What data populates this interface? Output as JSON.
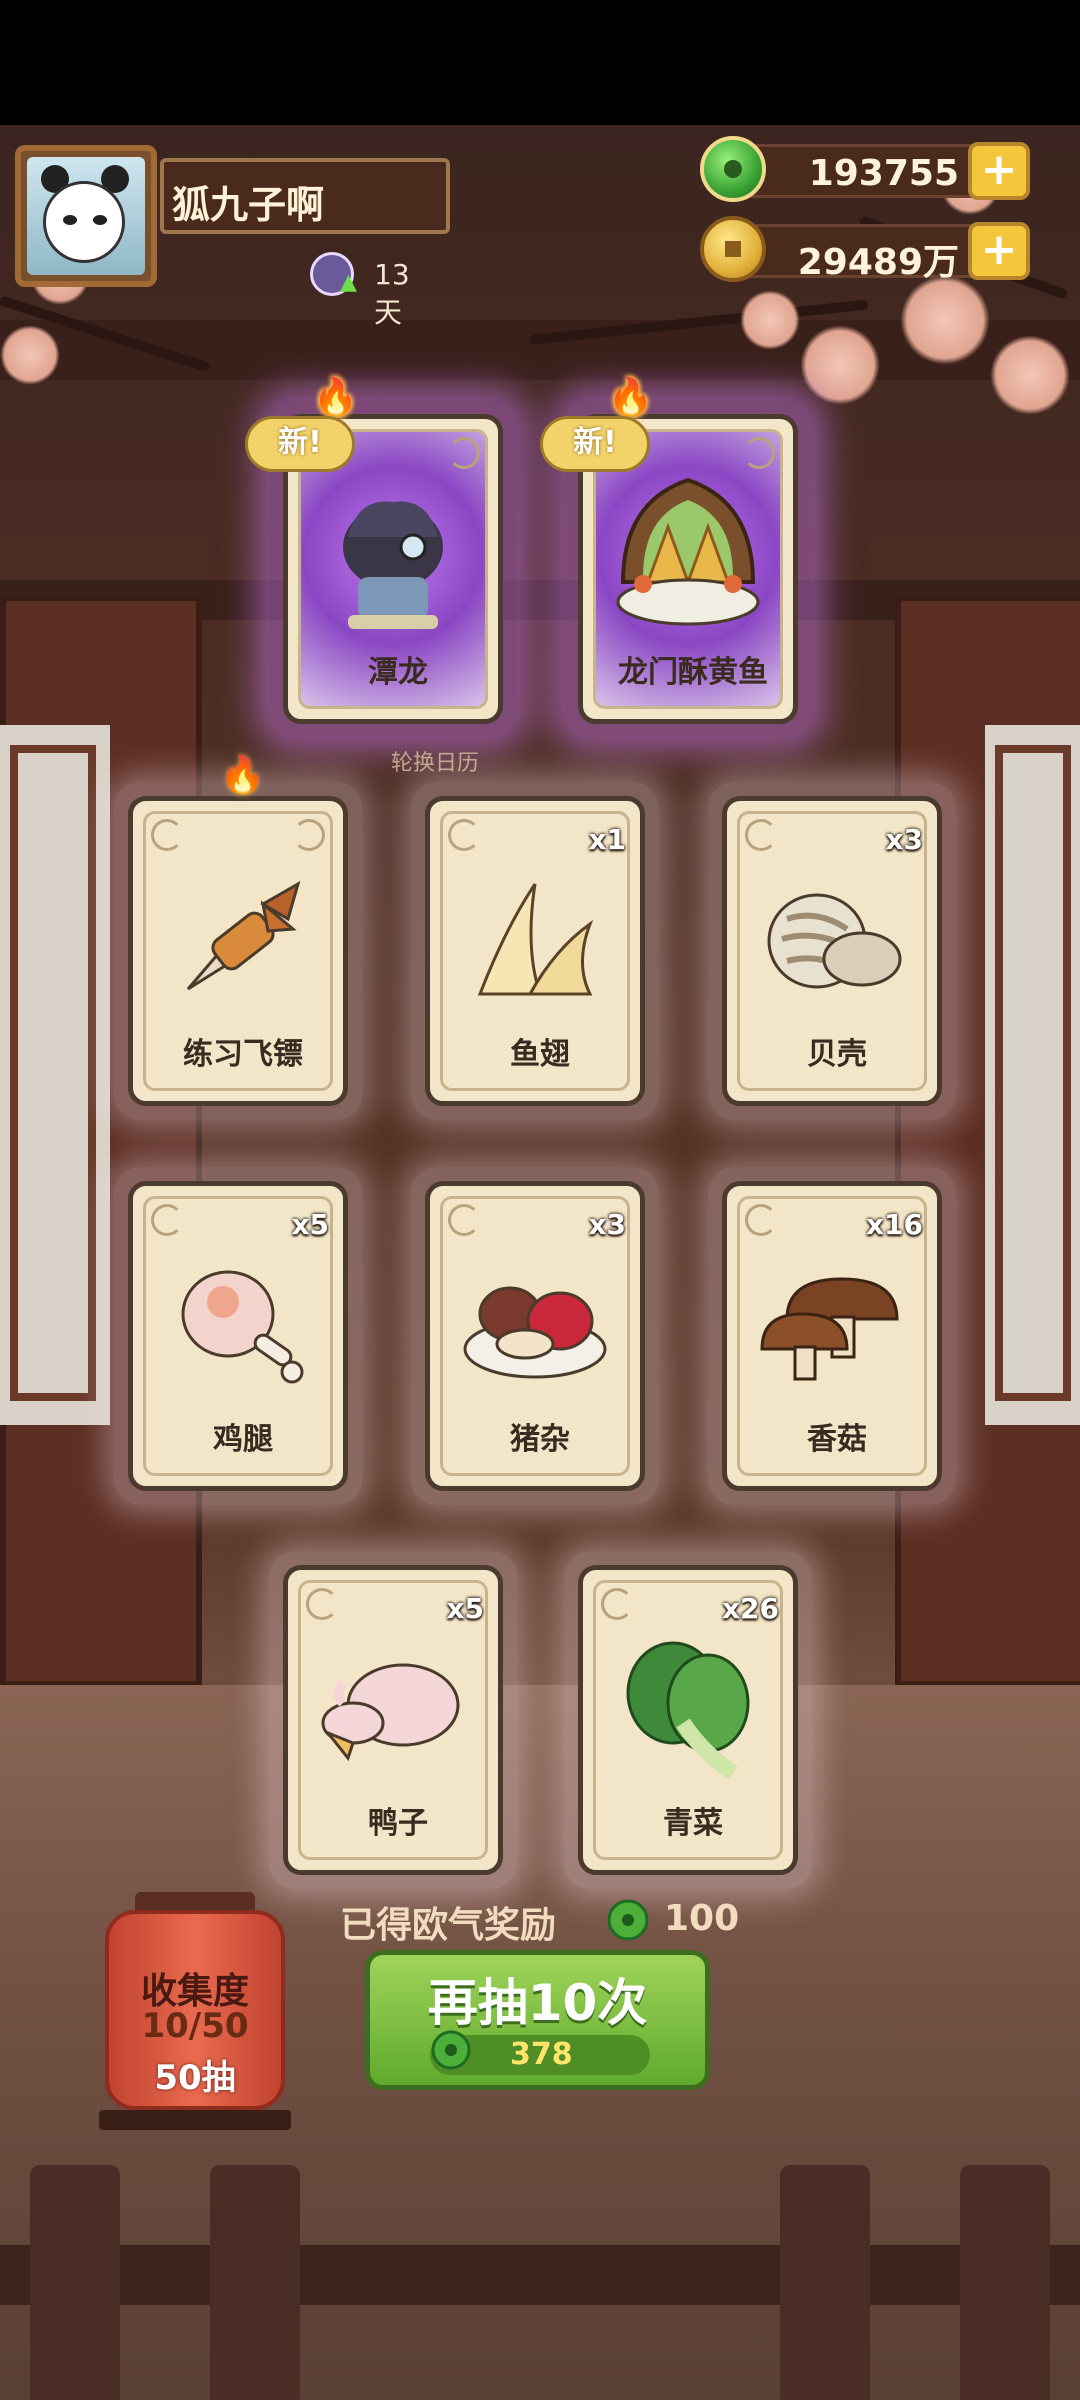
{
  "player": {
    "name": "狐九子啊",
    "days": "13天",
    "avatar": "panda-avatar"
  },
  "currencies": {
    "jade": {
      "value": "193755",
      "icon": "jade-icon"
    },
    "coins": {
      "value": "29489万",
      "icon": "coin-icon"
    }
  },
  "new_badge": "新!",
  "rare_cards": [
    {
      "label": "潭龙",
      "new": true,
      "fires": 4,
      "item": "dragon"
    },
    {
      "label": "龙门酥黄鱼",
      "new": true,
      "fires": 4,
      "item": "fried-fish"
    }
  ],
  "calendar_label": "轮换日历",
  "cards": [
    {
      "label": "练习飞镖",
      "count": "",
      "fires": 1,
      "item": "dart"
    },
    {
      "label": "鱼翅",
      "count": "x1",
      "item": "shark-fin"
    },
    {
      "label": "贝壳",
      "count": "x3",
      "item": "shell"
    },
    {
      "label": "鸡腿",
      "count": "x5",
      "item": "chicken-leg"
    },
    {
      "label": "猪杂",
      "count": "x3",
      "item": "pork-offal"
    },
    {
      "label": "香菇",
      "count": "x16",
      "item": "mushroom"
    },
    {
      "label": "鸭子",
      "count": "x5",
      "item": "duck"
    },
    {
      "label": "青菜",
      "count": "x26",
      "item": "greens"
    }
  ],
  "reward": {
    "label": "已得欧气奖励",
    "value": "100"
  },
  "draw_button": {
    "label": "再抽10次",
    "cost": "378"
  },
  "collection": {
    "title": "收集度",
    "progress": "10/50",
    "draws": "50抽"
  },
  "colors": {
    "rare_glow": "#b46ae0",
    "button_green": "#7cc243",
    "card_bg": "#f3e6c8"
  }
}
